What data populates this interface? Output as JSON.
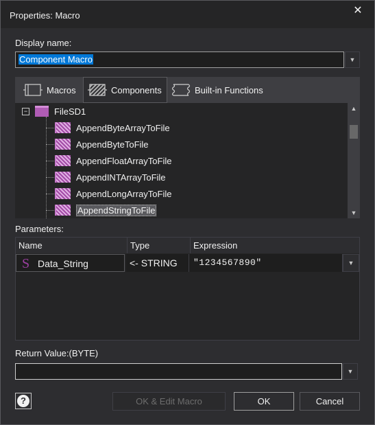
{
  "window": {
    "title": "Properties: Macro",
    "close_glyph": "✕"
  },
  "display_name": {
    "label": "Display name:",
    "value": "Component Macro"
  },
  "tabs": [
    {
      "label": "Macros",
      "icon": "macro-bracket-icon"
    },
    {
      "label": "Components",
      "icon": "component-bracket-icon",
      "active": true
    },
    {
      "label": "Built-in Functions",
      "icon": "builtin-bracket-icon"
    }
  ],
  "tree": {
    "root": {
      "expander": "−",
      "label": "FileSD1"
    },
    "items": [
      "AppendByteArrayToFile",
      "AppendByteToFile",
      "AppendFloatArrayToFile",
      "AppendINTArrayToFile",
      "AppendLongArrayToFile",
      "AppendStringToFile"
    ],
    "selected_index": 5
  },
  "parameters": {
    "label": "Parameters:",
    "headers": {
      "name": "Name",
      "type": "Type",
      "expression": "Expression"
    },
    "rows": [
      {
        "type_glyph": "S",
        "name": "Data_String",
        "type": "<- STRING",
        "expression": "\"1234567890\""
      }
    ]
  },
  "return_value": {
    "label": "Return Value:(BYTE)",
    "value": ""
  },
  "buttons": {
    "help": "?",
    "ok_edit": "OK & Edit Macro",
    "ok": "OK",
    "cancel": "Cancel"
  },
  "colors": {
    "accent": "#0078d7",
    "macro_icon": "#a24ba6",
    "string_type": "#9b3fa0"
  }
}
